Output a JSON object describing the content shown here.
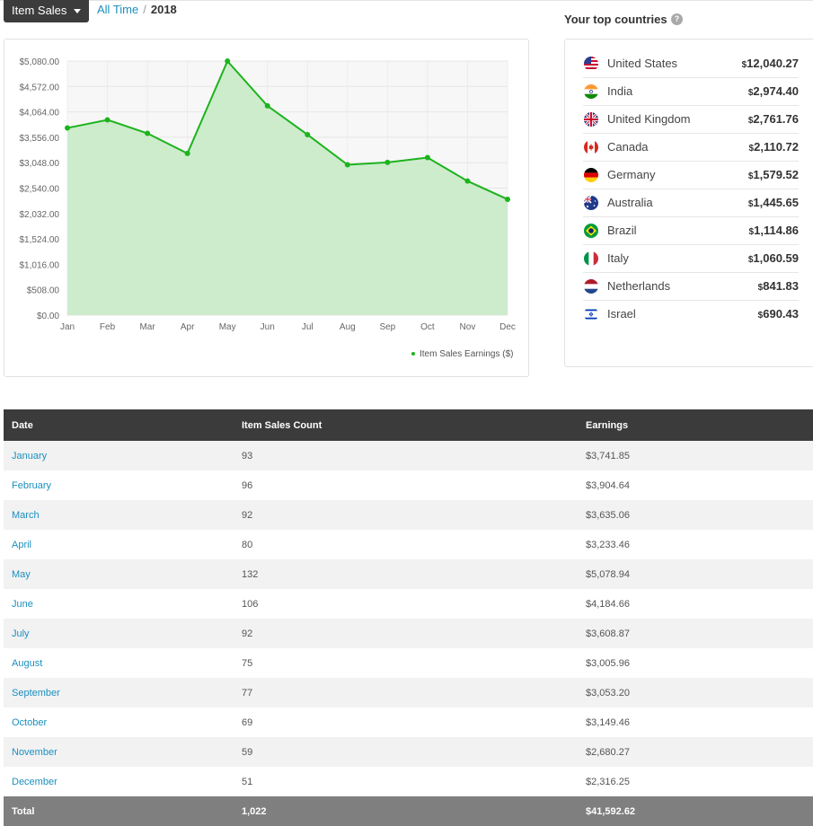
{
  "header": {
    "dropdown_label": "Item Sales",
    "breadcrumb_link": "All Time",
    "breadcrumb_sep": "/",
    "breadcrumb_current": "2018"
  },
  "countries": {
    "title": "Your top countries",
    "help": "?",
    "currency_symbol": "$",
    "items": [
      {
        "name": "United States",
        "amount": "12,040.27",
        "flag": "us-flag-icon"
      },
      {
        "name": "India",
        "amount": "2,974.40",
        "flag": "india-flag-icon"
      },
      {
        "name": "United Kingdom",
        "amount": "2,761.76",
        "flag": "uk-flag-icon"
      },
      {
        "name": "Canada",
        "amount": "2,110.72",
        "flag": "canada-flag-icon"
      },
      {
        "name": "Germany",
        "amount": "1,579.52",
        "flag": "germany-flag-icon"
      },
      {
        "name": "Australia",
        "amount": "1,445.65",
        "flag": "australia-flag-icon"
      },
      {
        "name": "Brazil",
        "amount": "1,114.86",
        "flag": "brazil-flag-icon"
      },
      {
        "name": "Italy",
        "amount": "1,060.59",
        "flag": "italy-flag-icon"
      },
      {
        "name": "Netherlands",
        "amount": "841.83",
        "flag": "netherlands-flag-icon"
      },
      {
        "name": "Israel",
        "amount": "690.43",
        "flag": "israel-flag-icon"
      }
    ]
  },
  "chart_data": {
    "type": "area",
    "categories": [
      "Jan",
      "Feb",
      "Mar",
      "Apr",
      "May",
      "Jun",
      "Jul",
      "Aug",
      "Sep",
      "Oct",
      "Nov",
      "Dec"
    ],
    "series": [
      {
        "name": "Item Sales Earnings ($)",
        "values": [
          3741.85,
          3904.64,
          3635.06,
          3233.46,
          5078.94,
          4184.66,
          3608.87,
          3005.96,
          3053.2,
          3149.46,
          2680.27,
          2316.25
        ],
        "color": "#1db31d"
      }
    ],
    "yticks": [
      "$5,080.00",
      "$4,572.00",
      "$4,064.00",
      "$3,556.00",
      "$3,048.00",
      "$2,540.00",
      "$2,032.00",
      "$1,524.00",
      "$1,016.00",
      "$508.00",
      "$0.00"
    ],
    "ylim": [
      0,
      5080
    ],
    "fill_color": "#cdeccc",
    "grid": true,
    "legend_position": "bottom-right"
  },
  "table": {
    "headers": [
      "Date",
      "Item Sales Count",
      "Earnings"
    ],
    "rows": [
      [
        "January",
        "93",
        "$3,741.85"
      ],
      [
        "February",
        "96",
        "$3,904.64"
      ],
      [
        "March",
        "92",
        "$3,635.06"
      ],
      [
        "April",
        "80",
        "$3,233.46"
      ],
      [
        "May",
        "132",
        "$5,078.94"
      ],
      [
        "June",
        "106",
        "$4,184.66"
      ],
      [
        "July",
        "92",
        "$3,608.87"
      ],
      [
        "August",
        "75",
        "$3,005.96"
      ],
      [
        "September",
        "77",
        "$3,053.20"
      ],
      [
        "October",
        "69",
        "$3,149.46"
      ],
      [
        "November",
        "59",
        "$2,680.27"
      ],
      [
        "December",
        "51",
        "$2,316.25"
      ]
    ],
    "total": [
      "Total",
      "1,022",
      "$41,592.62"
    ]
  }
}
